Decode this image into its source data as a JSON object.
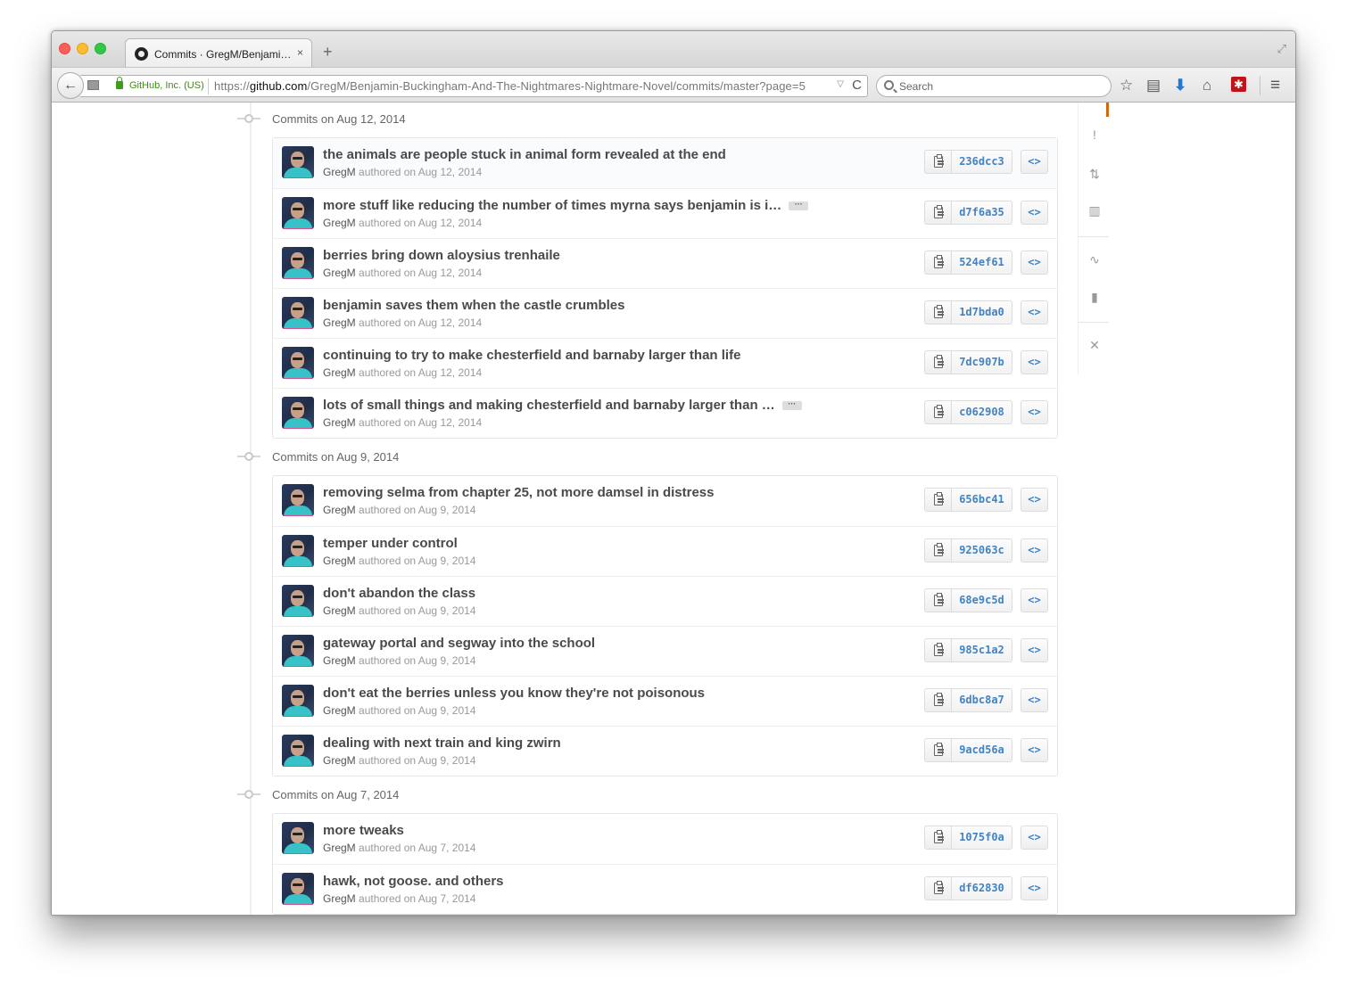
{
  "browser": {
    "tab_title": "Commits · GregM/Benjami…",
    "tab_close": "×",
    "new_tab": "+",
    "back": "←",
    "identity": "GitHub, Inc. (US)",
    "url_prefix": "https://",
    "url_host": "github.com",
    "url_path": "/GregM/Benjamin-Buckingham-And-The-Nightmares-Nightmare-Novel/commits/master?page=5",
    "url_dropdown": "▽",
    "reload": "C",
    "search_placeholder": "Search",
    "icons": {
      "star": "☆",
      "reading": "▤",
      "download": "⬇",
      "home": "⌂",
      "ext": "✱",
      "menu": "≡",
      "fullscreen": "⤢"
    }
  },
  "repo_nav": {
    "icons": [
      "!",
      "⇅",
      "▥",
      "∿",
      "▮",
      "✕"
    ]
  },
  "groups": [
    {
      "label": "Commits on Aug 12, 2014",
      "commits": [
        {
          "message": "the animals are people stuck in animal form revealed at the end",
          "author": "GregM",
          "authored": "authored on Aug 12, 2014",
          "sha": "236dcc3",
          "expand": false
        },
        {
          "message": "more stuff like reducing the number of times myrna says benjamin is i…",
          "author": "GregM",
          "authored": "authored on Aug 12, 2014",
          "sha": "d7f6a35",
          "expand": true
        },
        {
          "message": "berries bring down aloysius trenhaile",
          "author": "GregM",
          "authored": "authored on Aug 12, 2014",
          "sha": "524ef61",
          "expand": false
        },
        {
          "message": "benjamin saves them when the castle crumbles",
          "author": "GregM",
          "authored": "authored on Aug 12, 2014",
          "sha": "1d7bda0",
          "expand": false
        },
        {
          "message": "continuing to try to make chesterfield and barnaby larger than life",
          "author": "GregM",
          "authored": "authored on Aug 12, 2014",
          "sha": "7dc907b",
          "expand": false
        },
        {
          "message": "lots of small things and making chesterfield and barnaby larger than …",
          "author": "GregM",
          "authored": "authored on Aug 12, 2014",
          "sha": "c062908",
          "expand": true
        }
      ]
    },
    {
      "label": "Commits on Aug 9, 2014",
      "commits": [
        {
          "message": "removing selma from chapter 25, not more damsel in distress",
          "author": "GregM",
          "authored": "authored on Aug 9, 2014",
          "sha": "656bc41",
          "expand": false
        },
        {
          "message": "temper under control",
          "author": "GregM",
          "authored": "authored on Aug 9, 2014",
          "sha": "925063c",
          "expand": false
        },
        {
          "message": "don't abandon the class",
          "author": "GregM",
          "authored": "authored on Aug 9, 2014",
          "sha": "68e9c5d",
          "expand": false
        },
        {
          "message": "gateway portal and segway into the school",
          "author": "GregM",
          "authored": "authored on Aug 9, 2014",
          "sha": "985c1a2",
          "expand": false
        },
        {
          "message": "don't eat the berries unless you know they're not poisonous",
          "author": "GregM",
          "authored": "authored on Aug 9, 2014",
          "sha": "6dbc8a7",
          "expand": false
        },
        {
          "message": "dealing with next train and king zwirn",
          "author": "GregM",
          "authored": "authored on Aug 9, 2014",
          "sha": "9acd56a",
          "expand": false
        }
      ]
    },
    {
      "label": "Commits on Aug 7, 2014",
      "commits": [
        {
          "message": "more tweaks",
          "author": "GregM",
          "authored": "authored on Aug 7, 2014",
          "sha": "1075f0a",
          "expand": false
        },
        {
          "message": "hawk, not goose. and others",
          "author": "GregM",
          "authored": "authored on Aug 7, 2014",
          "sha": "df62830",
          "expand": false
        }
      ]
    }
  ],
  "ui": {
    "ellipsis": "···",
    "browse_glyph": "<>"
  }
}
